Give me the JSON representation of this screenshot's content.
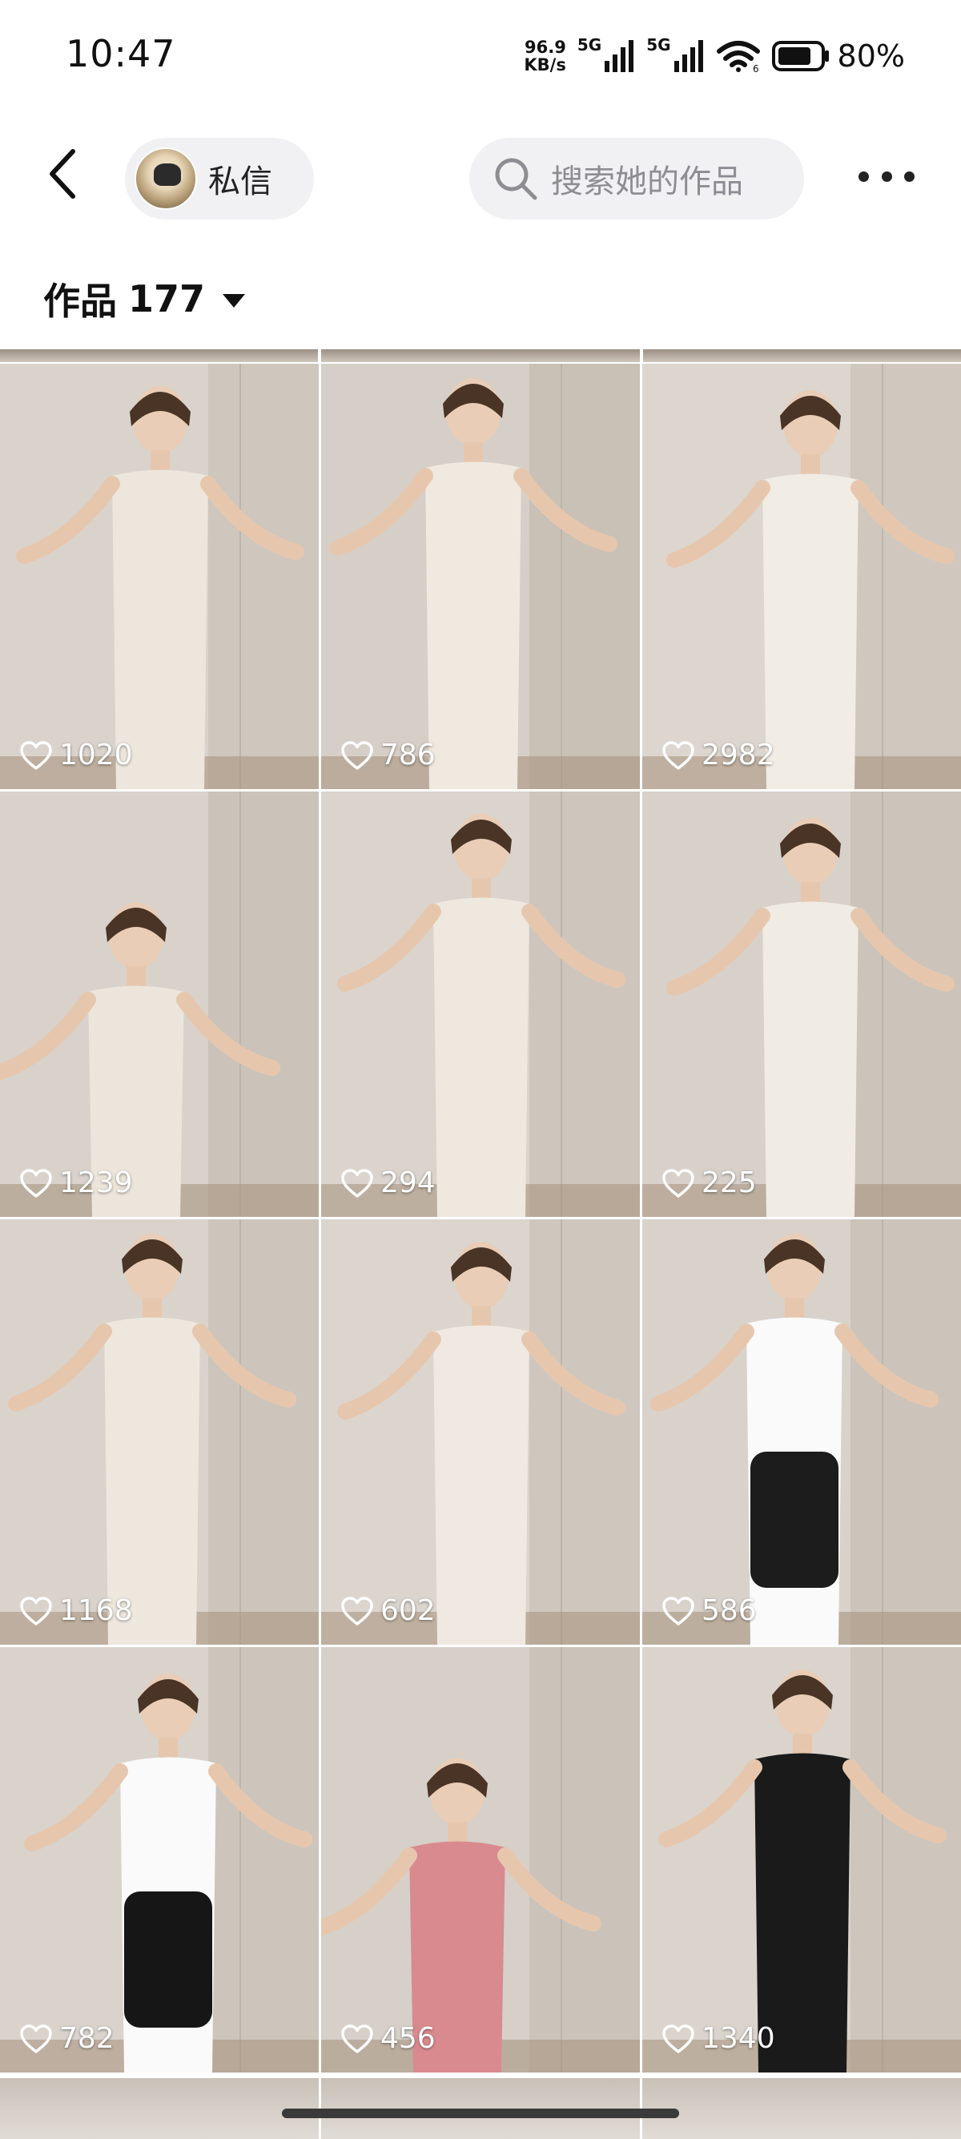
{
  "status_bar": {
    "time": "10:47",
    "net_speed_value": "96.9",
    "net_speed_unit": "KB/s",
    "sim1_label": "5G",
    "sim2_label": "5G",
    "wifi_icon": "wifi-icon",
    "battery_percent": "80%",
    "battery_level": 0.8
  },
  "header": {
    "back_icon": "chevron-left-icon",
    "dm_label": "私信",
    "search_placeholder": "搜索她的作品",
    "more_icon": "more-dots-icon"
  },
  "works": {
    "label": "作品",
    "count": "177",
    "dropdown_icon": "caret-down-icon"
  },
  "tiles": [
    {
      "likes": "1020"
    },
    {
      "likes": "786"
    },
    {
      "likes": "2982"
    },
    {
      "likes": "1239"
    },
    {
      "likes": "294"
    },
    {
      "likes": "225"
    },
    {
      "likes": "1168"
    },
    {
      "likes": "602"
    },
    {
      "likes": "586"
    },
    {
      "likes": "782"
    },
    {
      "likes": "456"
    },
    {
      "likes": "1340"
    }
  ],
  "colors": {
    "pill_bg": "#f1f1f3",
    "placeholder": "#8d8d93",
    "text": "#111111"
  }
}
